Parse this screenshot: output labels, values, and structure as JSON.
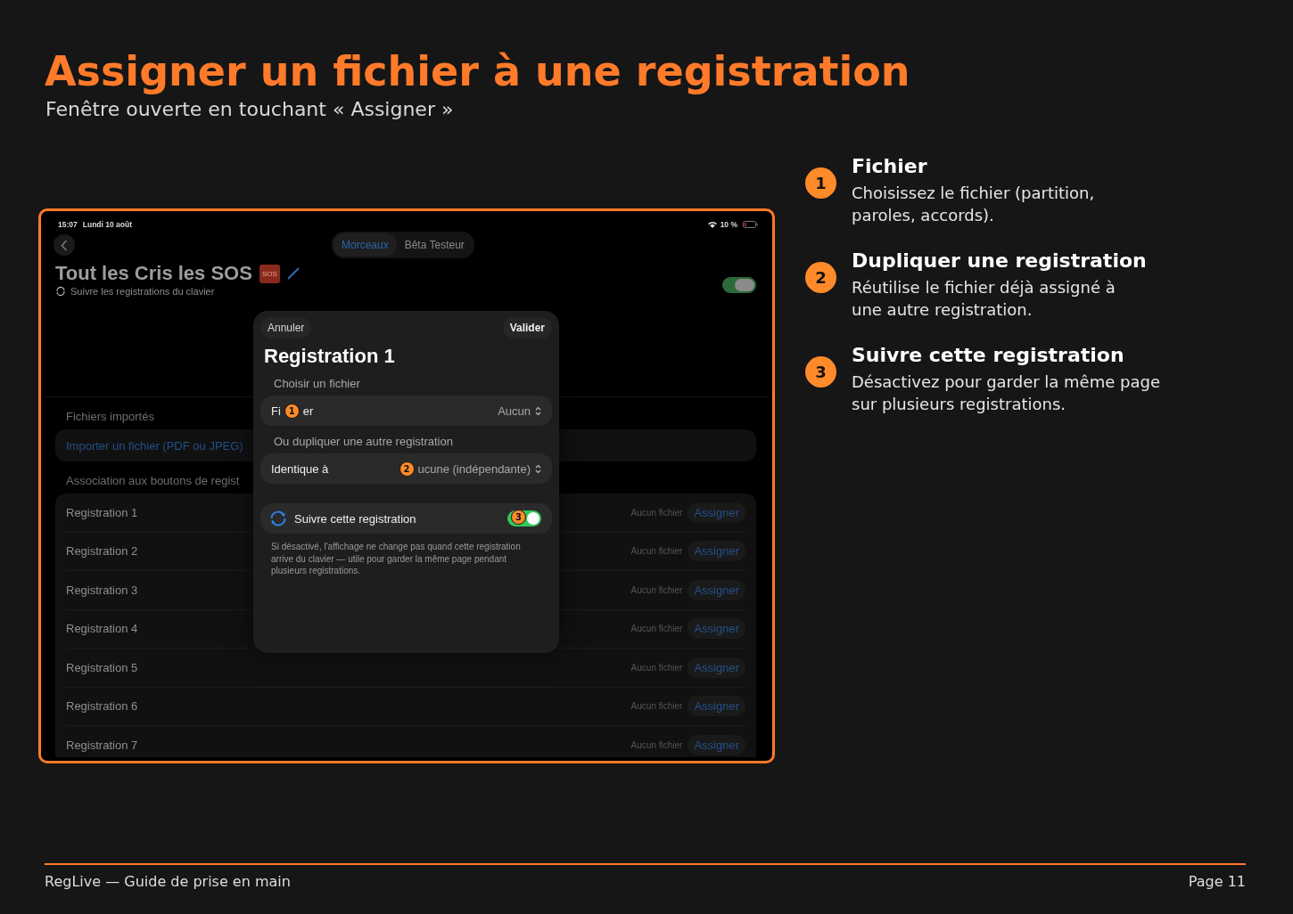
{
  "header": {
    "title": "Assigner un fichier à une registration",
    "subtitle": "Fenêtre ouverte en touchant « Assigner »"
  },
  "screenshot": {
    "status_bar": {
      "time": "15:07",
      "date": "Lundi 10 août",
      "battery": "10 %"
    },
    "segments": [
      {
        "label": "Morceaux",
        "selected": true
      },
      {
        "label": "Bêta Testeur",
        "selected": false
      }
    ],
    "song": {
      "title": "Tout les Cris les SOS",
      "badge": "SOS",
      "follow_label": "Suivre les registrations du clavier",
      "follow_on": true
    },
    "imported": {
      "heading": "Fichiers importés",
      "import_link": "Importer un fichier (PDF ou JPEG)"
    },
    "association": {
      "heading": "Association aux boutons de regist",
      "rows": [
        {
          "name": "Registration 1",
          "file": "Aucun fichier",
          "action": "Assigner"
        },
        {
          "name": "Registration 2",
          "file": "Aucun fichier",
          "action": "Assigner"
        },
        {
          "name": "Registration 3",
          "file": "Aucun fichier",
          "action": "Assigner"
        },
        {
          "name": "Registration 4",
          "file": "Aucun fichier",
          "action": "Assigner"
        },
        {
          "name": "Registration 5",
          "file": "Aucun fichier",
          "action": "Assigner"
        },
        {
          "name": "Registration 6",
          "file": "Aucun fichier",
          "action": "Assigner"
        },
        {
          "name": "Registration 7",
          "file": "Aucun fichier",
          "action": "Assigner"
        }
      ]
    },
    "sheet": {
      "cancel": "Annuler",
      "confirm": "Valider",
      "title": "Registration 1",
      "file_section": "Choisir un fichier",
      "file_label_start": "Fi",
      "file_marker": "1",
      "file_label_end": "er",
      "file_value": "Aucun",
      "duplicate_section": "Ou dupliquer une autre registration",
      "duplicate_label": "Identique à",
      "duplicate_marker": "2",
      "duplicate_value": "ucune (indépendante)",
      "follow_label": "Suivre cette registration",
      "follow_on": true,
      "follow_marker": "3",
      "note": "Si désactivé, l'affichage ne change pas quand cette registration arrive du clavier — utile pour garder la même page pendant plusieurs registrations."
    }
  },
  "callouts": [
    {
      "number": "1",
      "title": "Fichier",
      "lines": [
        "Choisissez le fichier (partition,",
        "paroles, accords)."
      ]
    },
    {
      "number": "2",
      "title": "Dupliquer une registration",
      "lines": [
        "Réutilise le fichier déjà assigné à",
        "une autre registration."
      ]
    },
    {
      "number": "3",
      "title": "Suivre cette registration",
      "lines": [
        "Désactivez pour garder la même page",
        "sur plusieurs registrations."
      ]
    }
  ],
  "footer": {
    "left": "RegLive — Guide de prise en main",
    "right": "Page 11"
  }
}
